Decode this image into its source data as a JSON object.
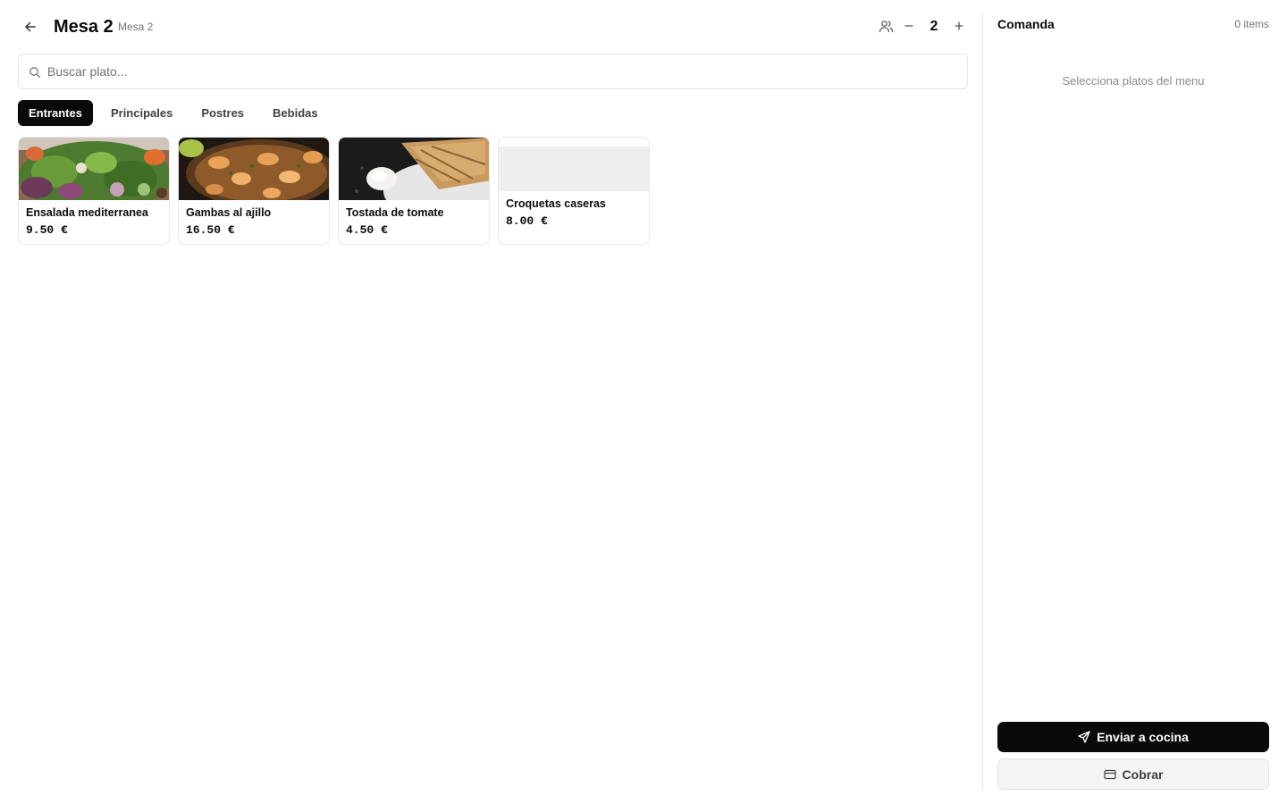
{
  "header": {
    "title": "Mesa 2",
    "subtitle": "Mesa 2",
    "guest_count": "2",
    "icons": {
      "back": "arrow-left-icon",
      "people": "users-icon",
      "minus": "minus-icon",
      "plus": "plus-icon"
    }
  },
  "search": {
    "placeholder": "Buscar plato...",
    "value": "",
    "icon": "search-icon"
  },
  "tabs": [
    {
      "label": "Entrantes",
      "active": true
    },
    {
      "label": "Principales",
      "active": false
    },
    {
      "label": "Postres",
      "active": false
    },
    {
      "label": "Bebidas",
      "active": false
    }
  ],
  "dishes": [
    {
      "name": "Ensalada mediterranea",
      "price": "9.50 €",
      "image": "salad-photo"
    },
    {
      "name": "Gambas al ajillo",
      "price": "16.50 €",
      "image": "prawns-photo"
    },
    {
      "name": "Tostada de tomate",
      "price": "4.50 €",
      "image": "toast-photo"
    },
    {
      "name": "Croquetas caseras",
      "price": "8.00 €",
      "image": "placeholder"
    }
  ],
  "order": {
    "title": "Comanda",
    "count": "0 items",
    "empty_message": "Selecciona platos del menu",
    "send_label": "Enviar a cocina",
    "send_icon": "send-icon",
    "pay_label": "Cobrar",
    "pay_icon": "credit-card-icon"
  },
  "colors": {
    "primary": "#0a0a0a",
    "muted_text": "#737373",
    "border": "#e5e5e5",
    "secondary_bg": "#f5f5f5"
  }
}
